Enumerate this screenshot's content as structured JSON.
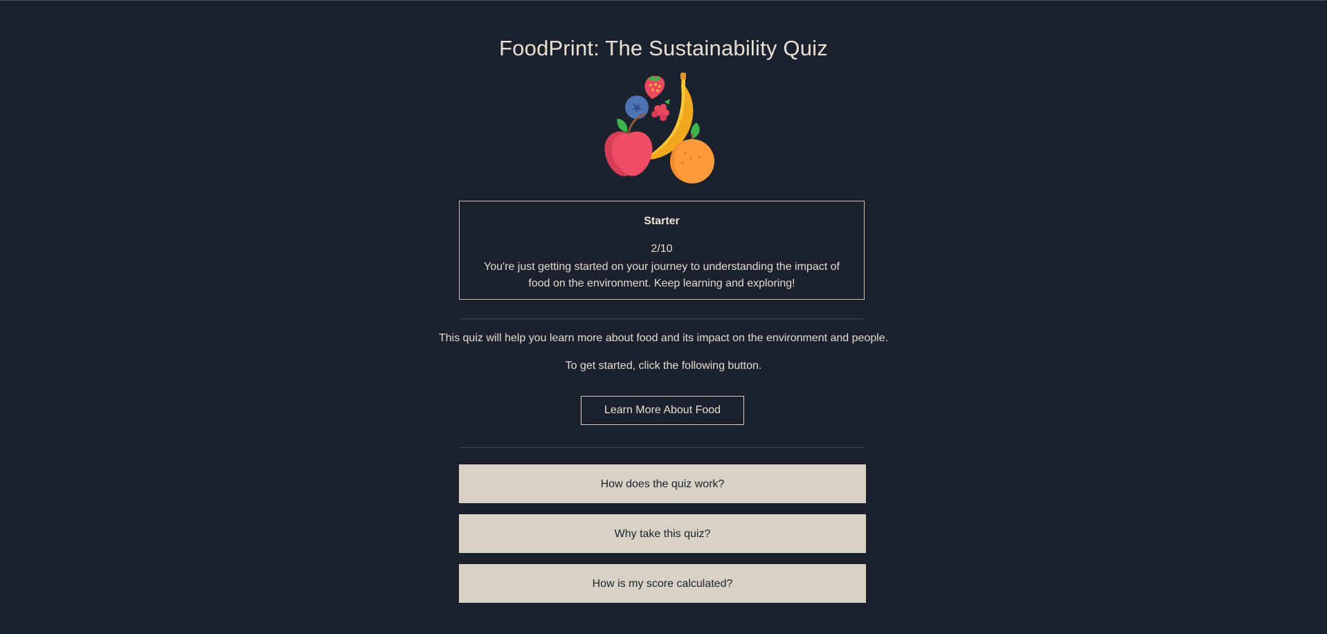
{
  "page": {
    "title": "FoodPrint: The Sustainability Quiz"
  },
  "hero": {
    "icon": "fruits-icon"
  },
  "score": {
    "level": "Starter",
    "value": "2/10",
    "description": "You're just getting started on your journey to understanding the impact of food on the environment. Keep learning and exploring!"
  },
  "intro": {
    "line1": "This quiz will help you learn more about food and its impact on the environment and people.",
    "line2": "To get started, click the following button."
  },
  "actions": {
    "learn_label": "Learn More About Food"
  },
  "faq": [
    {
      "label": "How does the quiz work?"
    },
    {
      "label": "Why take this quiz?"
    },
    {
      "label": "How is my score calculated?"
    }
  ],
  "colors": {
    "background": "#1b212d",
    "text": "#e4ddd0",
    "faq_background": "#d8d2c5",
    "faq_text": "#1b212d",
    "border": "#c9c3b7"
  }
}
